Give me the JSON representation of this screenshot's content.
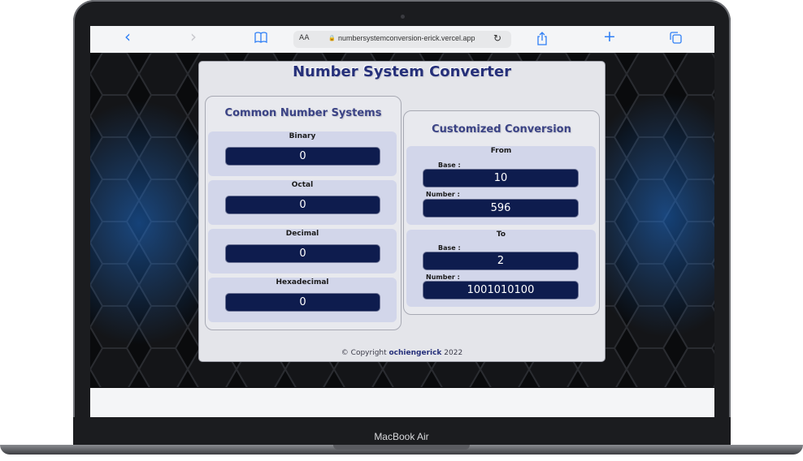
{
  "browser": {
    "nav_back": "‹",
    "nav_forward": "›",
    "bookmarks_icon": "book-icon",
    "text_size": "AA",
    "lock": "🔒",
    "url": "numbersystemconversion-erick.vercel.app",
    "reload": "↻",
    "share_icon": "share-icon",
    "new_tab": "+",
    "tabs_icon": "tabs-icon"
  },
  "device": {
    "model": "MacBook Air"
  },
  "app": {
    "title": "Number System Converter",
    "common": {
      "heading": "Common Number Systems",
      "binary_label": "Binary",
      "binary_value": "0",
      "octal_label": "Octal",
      "octal_value": "0",
      "decimal_label": "Decimal",
      "decimal_value": "0",
      "hex_label": "Hexadecimal",
      "hex_value": "0"
    },
    "custom": {
      "heading": "Customized Conversion",
      "from_label": "From",
      "from_base_label": "Base :",
      "from_base_value": "10",
      "from_number_label": "Number :",
      "from_number_value": "596",
      "to_label": "To",
      "to_base_label": "Base :",
      "to_base_value": "2",
      "to_number_label": "Number :",
      "to_number_value": "1001010100"
    },
    "footer_prefix": "© Copyright ",
    "footer_author": "ochiengerick",
    "footer_year": " 2022"
  },
  "colors": {
    "accent": "#2f7ff5",
    "field": "#0e1c4e",
    "title": "#26307a",
    "section": "#d2d6ea"
  }
}
